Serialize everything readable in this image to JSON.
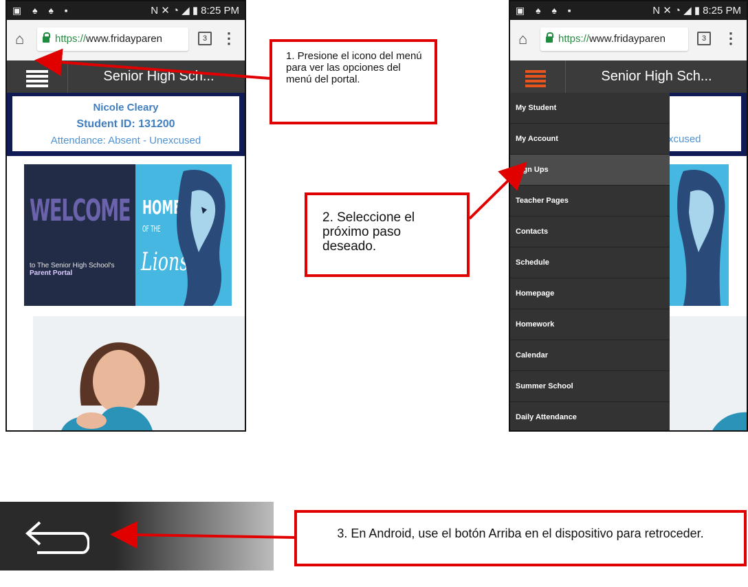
{
  "status_bar": {
    "time": "8:25 PM"
  },
  "browser": {
    "url_scheme": "https://",
    "url_host_left": "www.fridayparen",
    "url_host_right": "www.fridayparen",
    "tab_count": "3"
  },
  "left_screen": {
    "header_title": "Senior High Sch...",
    "student": {
      "name": "Nicole Cleary",
      "student_id": "Student ID: 131200",
      "attendance": "Attendance: Absent - Unexcused"
    },
    "banner": {
      "welcome": "WELCOME",
      "tagline_start": "to The Senior High School's ",
      "tagline_em": "Parent Portal",
      "home": "HOME",
      "of_the": "OF THE",
      "lions": "Lions"
    }
  },
  "right_screen": {
    "header_title": "Senior High Sch...",
    "partial_text": "xcused",
    "menu_items": [
      "My Student",
      "My Account",
      "Sign Ups",
      "Teacher Pages",
      "Contacts",
      "Schedule",
      "Homepage",
      "Homework",
      "Calendar",
      "Summer School",
      "Daily Attendance"
    ],
    "active_index": 2
  },
  "callouts": {
    "step1": "1. Presione el icono del menú para ver las opciones del menú del portal.",
    "step2": "2. Seleccione el próximo paso deseado.",
    "step3": "3. En Android, use el botón Arriba en el dispositivo para retroceder."
  },
  "colors": {
    "callout_border": "#e10000",
    "header_bg": "#3b3b3b",
    "menu_accent": "#e8551c",
    "student_box": "#101a55",
    "link_blue": "#3f7ec0"
  },
  "icons": {
    "home": "home-icon",
    "lock": "lock-icon",
    "tabs": "tab-switcher-icon",
    "more": "more-vert-icon",
    "menu": "hamburger-menu-icon",
    "back": "back-arrow-icon"
  }
}
